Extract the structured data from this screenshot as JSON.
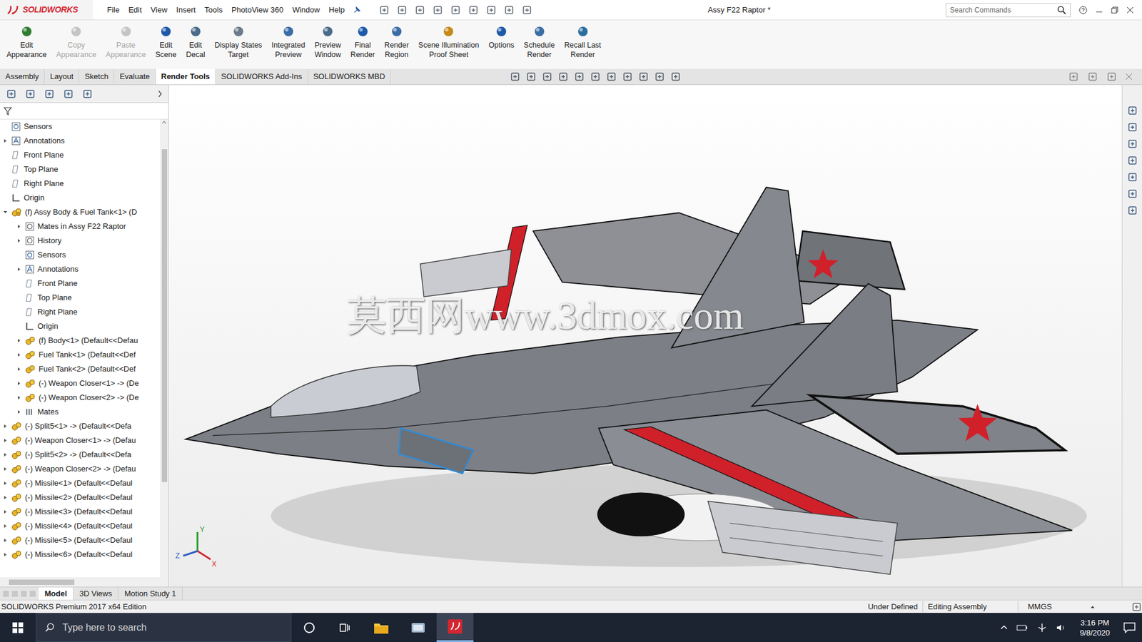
{
  "app": {
    "logo": "SOLIDWORKS",
    "title": "Assy F22 Raptor *"
  },
  "menu": [
    "File",
    "Edit",
    "View",
    "Insert",
    "Tools",
    "PhotoView 360",
    "Window",
    "Help"
  ],
  "search": {
    "placeholder": "Search Commands"
  },
  "ribbon": [
    {
      "lines": [
        "Edit",
        "Appearance"
      ],
      "disabled": false
    },
    {
      "lines": [
        "Copy",
        "Appearance"
      ],
      "disabled": true
    },
    {
      "lines": [
        "Paste",
        "Appearance"
      ],
      "disabled": true
    },
    {
      "lines": [
        "Edit",
        "Scene"
      ],
      "disabled": false
    },
    {
      "lines": [
        "Edit",
        "Decal"
      ],
      "disabled": false
    },
    {
      "lines": [
        "Display States",
        "Target"
      ],
      "disabled": false
    },
    {
      "lines": [
        "Integrated",
        "Preview"
      ],
      "disabled": false
    },
    {
      "lines": [
        "Preview",
        "Window"
      ],
      "disabled": false
    },
    {
      "lines": [
        "Final",
        "Render"
      ],
      "disabled": false
    },
    {
      "lines": [
        "Render",
        "Region"
      ],
      "disabled": false
    },
    {
      "lines": [
        "Scene Illumination",
        "Proof Sheet"
      ],
      "disabled": false
    },
    {
      "lines": [
        "Options"
      ],
      "disabled": false
    },
    {
      "lines": [
        "Schedule",
        "Render"
      ],
      "disabled": false
    },
    {
      "lines": [
        "Recall Last",
        "Render"
      ],
      "disabled": false
    }
  ],
  "tabs": [
    {
      "label": "Assembly",
      "selected": false
    },
    {
      "label": "Layout",
      "selected": false
    },
    {
      "label": "Sketch",
      "selected": false
    },
    {
      "label": "Evaluate",
      "selected": false
    },
    {
      "label": "Render Tools",
      "selected": true
    },
    {
      "label": "SOLIDWORKS Add-Ins",
      "selected": false
    },
    {
      "label": "SOLIDWORKS MBD",
      "selected": false
    }
  ],
  "tree": [
    {
      "label": "Sensors",
      "depth": 0,
      "kind": "sensor",
      "expandable": false,
      "expanded": false
    },
    {
      "label": "Annotations",
      "depth": 0,
      "kind": "annotation",
      "expandable": true,
      "expanded": false
    },
    {
      "label": "Front Plane",
      "depth": 0,
      "kind": "plane",
      "expandable": false,
      "expanded": false
    },
    {
      "label": "Top Plane",
      "depth": 0,
      "kind": "plane",
      "expandable": false,
      "expanded": false
    },
    {
      "label": "Right Plane",
      "depth": 0,
      "kind": "plane",
      "expandable": false,
      "expanded": false
    },
    {
      "label": "Origin",
      "depth": 0,
      "kind": "origin",
      "expandable": false,
      "expanded": false
    },
    {
      "label": "(f) Assy Body & Fuel Tank<1> (D",
      "depth": 0,
      "kind": "assembly",
      "expandable": true,
      "expanded": true
    },
    {
      "label": "Mates in Assy F22 Raptor",
      "depth": 1,
      "kind": "folder",
      "expandable": true,
      "expanded": false
    },
    {
      "label": "History",
      "depth": 1,
      "kind": "folder",
      "expandable": true,
      "expanded": false
    },
    {
      "label": "Sensors",
      "depth": 1,
      "kind": "sensor",
      "expandable": false,
      "expanded": false
    },
    {
      "label": "Annotations",
      "depth": 1,
      "kind": "annotation",
      "expandable": true,
      "expanded": false
    },
    {
      "label": "Front Plane",
      "depth": 1,
      "kind": "plane",
      "expandable": false,
      "expanded": false
    },
    {
      "label": "Top Plane",
      "depth": 1,
      "kind": "plane",
      "expandable": false,
      "expanded": false
    },
    {
      "label": "Right Plane",
      "depth": 1,
      "kind": "plane",
      "expandable": false,
      "expanded": false
    },
    {
      "label": "Origin",
      "depth": 1,
      "kind": "origin",
      "expandable": false,
      "expanded": false
    },
    {
      "label": "(f) Body<1> (Default<<Defau",
      "depth": 1,
      "kind": "part",
      "expandable": true,
      "expanded": false
    },
    {
      "label": "Fuel Tank<1> (Default<<Def",
      "depth": 1,
      "kind": "part",
      "expandable": true,
      "expanded": false
    },
    {
      "label": "Fuel Tank<2> (Default<<Def",
      "depth": 1,
      "kind": "part",
      "expandable": true,
      "expanded": false
    },
    {
      "label": "(-) Weapon Closer<1> -> (De",
      "depth": 1,
      "kind": "part",
      "expandable": true,
      "expanded": false
    },
    {
      "label": "(-) Weapon Closer<2> -> (De",
      "depth": 1,
      "kind": "part",
      "expandable": true,
      "expanded": false
    },
    {
      "label": "Mates",
      "depth": 1,
      "kind": "mates",
      "expandable": true,
      "expanded": false
    },
    {
      "label": "(-) Split5<1> -> (Default<<Defa",
      "depth": 0,
      "kind": "part",
      "expandable": true,
      "expanded": false
    },
    {
      "label": "(-) Weapon Closer<1> -> (Defau",
      "depth": 0,
      "kind": "part",
      "expandable": true,
      "expanded": false
    },
    {
      "label": "(-) Split5<2> -> (Default<<Defa",
      "depth": 0,
      "kind": "part",
      "expandable": true,
      "expanded": false
    },
    {
      "label": "(-) Weapon Closer<2> -> (Defau",
      "depth": 0,
      "kind": "part",
      "expandable": true,
      "expanded": false
    },
    {
      "label": "(-) Missile<1> (Default<<Defaul",
      "depth": 0,
      "kind": "part",
      "expandable": true,
      "expanded": false
    },
    {
      "label": "(-) Missile<2> (Default<<Defaul",
      "depth": 0,
      "kind": "part",
      "expandable": true,
      "expanded": false
    },
    {
      "label": "(-) Missile<3> (Default<<Defaul",
      "depth": 0,
      "kind": "part",
      "expandable": true,
      "expanded": false
    },
    {
      "label": "(-) Missile<4> (Default<<Defaul",
      "depth": 0,
      "kind": "part",
      "expandable": true,
      "expanded": false
    },
    {
      "label": "(-) Missile<5> (Default<<Defaul",
      "depth": 0,
      "kind": "part",
      "expandable": true,
      "expanded": false
    },
    {
      "label": "(-) Missile<6> (Default<<Defaul",
      "depth": 0,
      "kind": "part",
      "expandable": true,
      "expanded": false
    }
  ],
  "viewport": {
    "watermark": "莫西网www.3dmox.com",
    "axes": [
      "Y",
      "X",
      "Z"
    ]
  },
  "bottom_tabs": [
    {
      "label": "Model",
      "selected": true
    },
    {
      "label": "3D Views",
      "selected": false
    },
    {
      "label": "Motion Study 1",
      "selected": false
    }
  ],
  "status_bar": {
    "edition": "SOLIDWORKS Premium 2017 x64 Edition",
    "state": "Under Defined",
    "mode": "Editing Assembly",
    "units": "MMGS"
  },
  "taskbar": {
    "search_placeholder": "Type here to search",
    "time": "3:16 PM",
    "date": "9/8/2020"
  }
}
